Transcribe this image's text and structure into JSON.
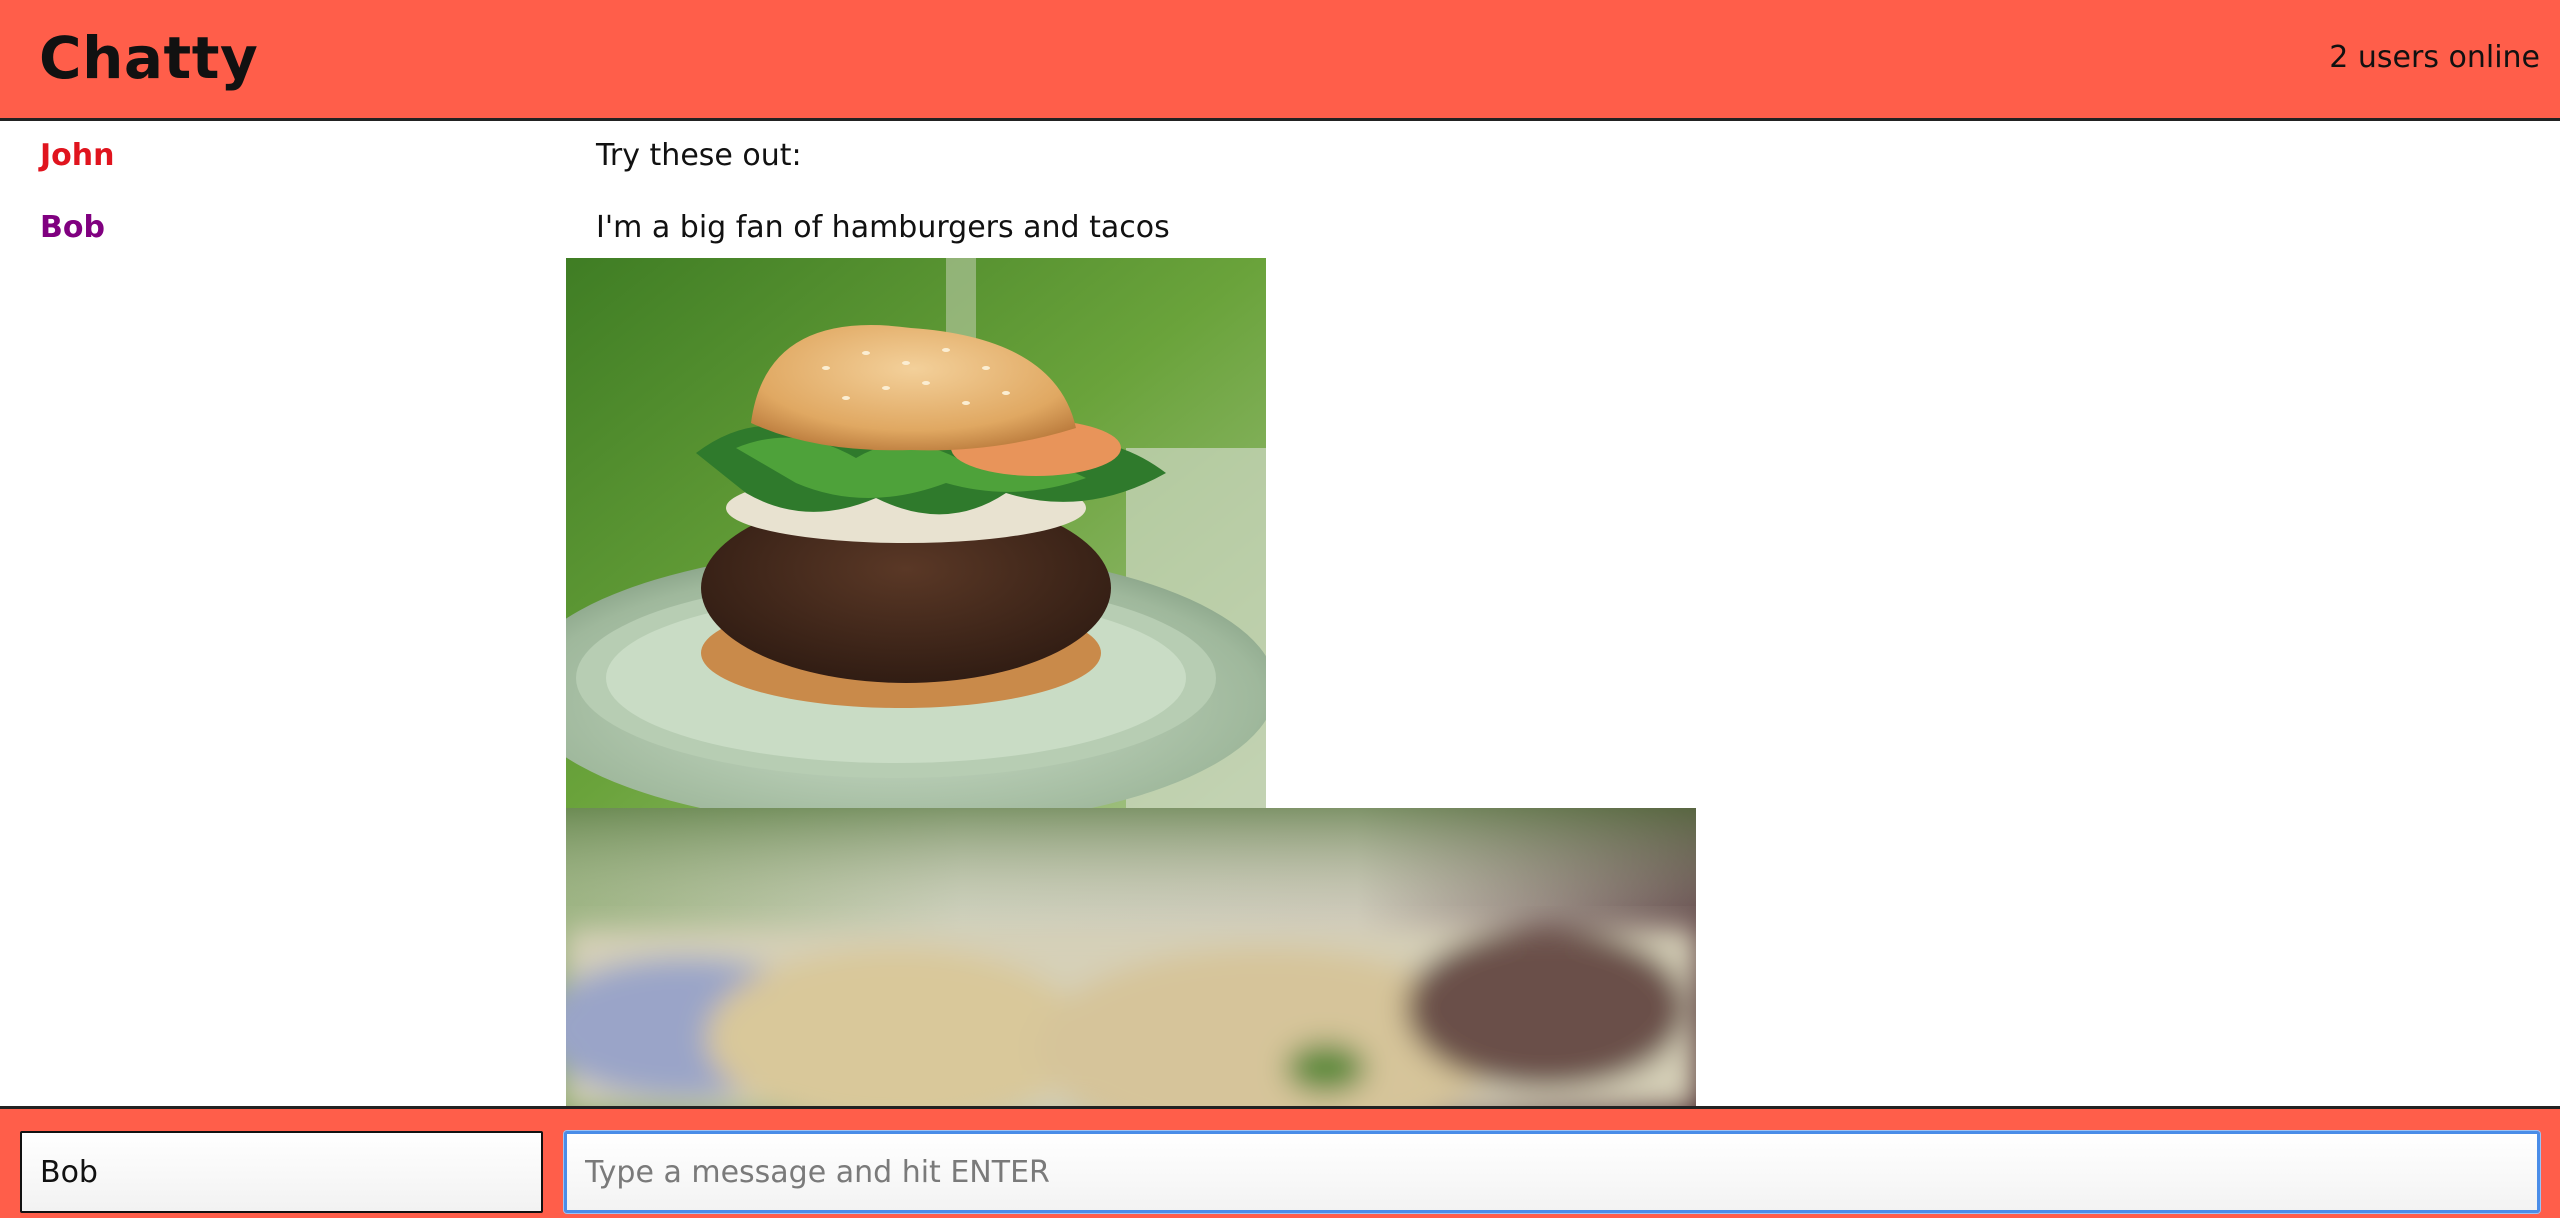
{
  "navbar": {
    "brand": "Chatty",
    "users_online": "2 users online"
  },
  "messages": [
    {
      "username": "John",
      "username_color": "#e0141e",
      "content": "Try these out:"
    },
    {
      "username": "Bob",
      "username_color": "#800080",
      "content": "I'm a big fan of hamburgers and tacos"
    }
  ],
  "images": [
    {
      "alt": "hamburger-photo",
      "description_icon": "hamburger-image"
    },
    {
      "alt": "tacos-photo",
      "description_icon": "tacos-image"
    }
  ],
  "chatbar": {
    "username_value": "Bob",
    "message_placeholder": "Type a message and hit ENTER",
    "message_value": ""
  },
  "colors": {
    "accent": "#ff5e4a",
    "focus_ring": "#4a8de8"
  }
}
